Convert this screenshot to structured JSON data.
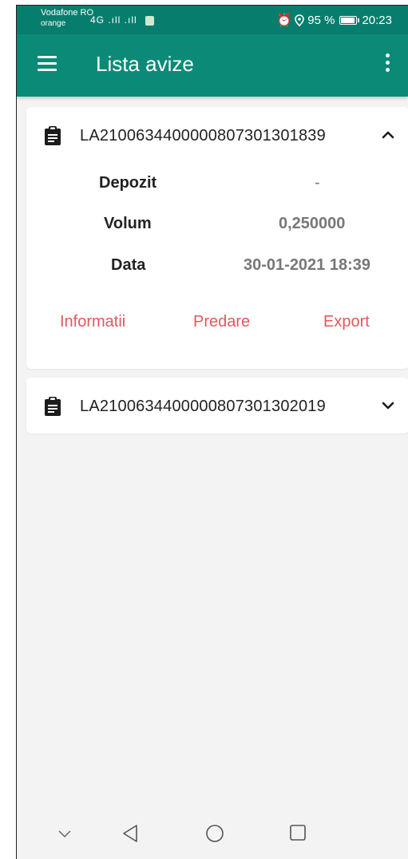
{
  "status_bar": {
    "carrier_line1": "Vodafone RO",
    "carrier_line2": "orange",
    "signal_text": "4G .ıll  .ıll",
    "battery_percent": "95 %",
    "battery_level": 0.95,
    "time": "20:23"
  },
  "app_bar": {
    "title": "Lista avize"
  },
  "cards": [
    {
      "id": "LA2100634400000807301301839",
      "expanded": true,
      "fields": [
        {
          "label": "Depozit",
          "value": "-"
        },
        {
          "label": "Volum",
          "value": "0,250000"
        },
        {
          "label": "Data",
          "value": "30-01-2021 18:39"
        }
      ],
      "actions": [
        "Informatii",
        "Predare",
        "Export"
      ]
    },
    {
      "id": "LA2100634400000807301302019",
      "expanded": false
    }
  ],
  "colors": {
    "app_bar": "#0b8a77",
    "status_bar": "#077e6d",
    "action_text": "#e0585b",
    "background": "#f3f3f3"
  }
}
